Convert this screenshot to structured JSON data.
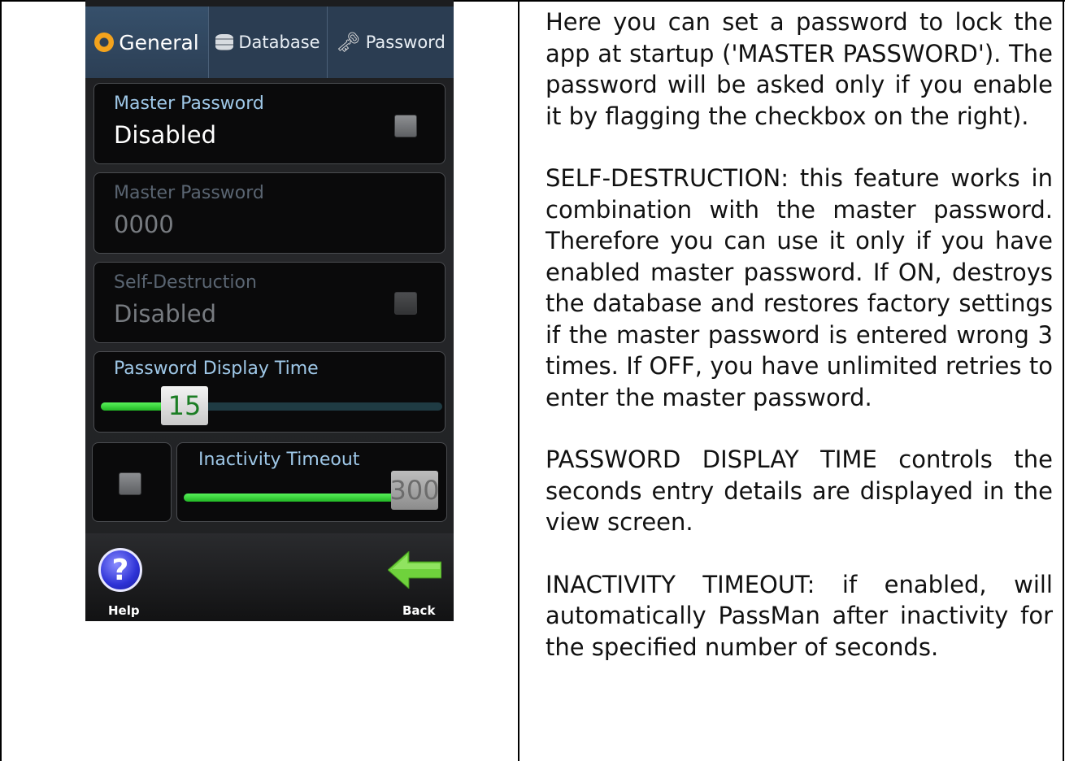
{
  "phone": {
    "tabs": [
      {
        "label": "General",
        "icon": "gear-icon",
        "active": true
      },
      {
        "label": "Database",
        "icon": "database-icon",
        "active": false
      },
      {
        "label": "Password",
        "icon": "key-icon",
        "active": false
      }
    ],
    "master_password_toggle": {
      "label": "Master Password",
      "value": "Disabled",
      "checked": false
    },
    "master_password_field": {
      "label": "Master Password",
      "value": "0000",
      "enabled": false
    },
    "self_destruction": {
      "label": "Self-Destruction",
      "value": "Disabled",
      "checked": false,
      "enabled": false
    },
    "password_display_time": {
      "label": "Password Display Time",
      "value": "15",
      "fraction": 0.2
    },
    "inactivity_timeout": {
      "label": "Inactivity Timeout",
      "value": "300",
      "checked": false,
      "fraction": 1.0
    },
    "bottom": {
      "help_label": "Help",
      "back_label": "Back"
    }
  },
  "help_text": [
    "Here you can set a password to lock the app at startup ('MASTER PASSWORD'). The password will be asked only if you enable it by flagging the checkbox on the right).",
    "SELF-DESTRUCTION: this feature works in combination with the master password. Therefore you can use it only if you have enabled master password. If ON, destroys the database and restores factory settings if the master password is entered wrong 3 times. If OFF, you have unlimited retries to enter the master password.",
    "PASSWORD DISPLAY TIME controls the seconds entry details are displayed in the view screen.",
    "INACTIVITY TIMEOUT: if enabled, will automatically PassMan after inactivity for the specified number of seconds."
  ],
  "colors": {
    "accent_green": "#2fd634",
    "label_blue": "#9fc8e8",
    "tab_bg": "#2b3d52"
  }
}
